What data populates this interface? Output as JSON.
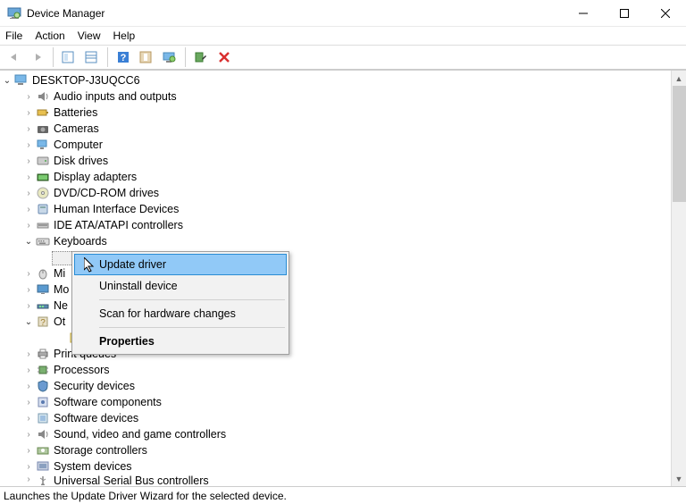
{
  "window": {
    "title": "Device Manager"
  },
  "menu": [
    "File",
    "Action",
    "View",
    "Help"
  ],
  "toolbar_icons": [
    "back",
    "forward",
    "show-hidden",
    "properties-pane",
    "help",
    "scan",
    "monitor",
    "add-legacy",
    "delete"
  ],
  "root": {
    "label": "DESKTOP-J3UQCC6"
  },
  "categories": [
    {
      "label": "Audio inputs and outputs",
      "expanded": false,
      "icon": "audio"
    },
    {
      "label": "Batteries",
      "expanded": false,
      "icon": "battery"
    },
    {
      "label": "Cameras",
      "expanded": false,
      "icon": "camera"
    },
    {
      "label": "Computer",
      "expanded": false,
      "icon": "computer"
    },
    {
      "label": "Disk drives",
      "expanded": false,
      "icon": "disk"
    },
    {
      "label": "Display adapters",
      "expanded": false,
      "icon": "display"
    },
    {
      "label": "DVD/CD-ROM drives",
      "expanded": false,
      "icon": "dvd"
    },
    {
      "label": "Human Interface Devices",
      "expanded": false,
      "icon": "hid"
    },
    {
      "label": "IDE ATA/ATAPI controllers",
      "expanded": false,
      "icon": "ide"
    },
    {
      "label": "Keyboards",
      "expanded": true,
      "icon": "keyboard"
    },
    {
      "label": "Mi",
      "expanded": false,
      "icon": "mouse",
      "truncated": true
    },
    {
      "label": "Mo",
      "expanded": false,
      "icon": "monitor",
      "truncated": true
    },
    {
      "label": "Ne",
      "expanded": false,
      "icon": "network",
      "truncated": true
    },
    {
      "label": "Ot",
      "expanded": true,
      "icon": "other",
      "truncated": true
    },
    {
      "label": "Print queues",
      "expanded": false,
      "icon": "printer"
    },
    {
      "label": "Processors",
      "expanded": false,
      "icon": "cpu"
    },
    {
      "label": "Security devices",
      "expanded": false,
      "icon": "security"
    },
    {
      "label": "Software components",
      "expanded": false,
      "icon": "swcomp"
    },
    {
      "label": "Software devices",
      "expanded": false,
      "icon": "swdev"
    },
    {
      "label": "Sound, video and game controllers",
      "expanded": false,
      "icon": "audio"
    },
    {
      "label": "Storage controllers",
      "expanded": false,
      "icon": "storage"
    },
    {
      "label": "System devices",
      "expanded": false,
      "icon": "system"
    },
    {
      "label": "Universal Serial Bus controllers",
      "expanded": false,
      "icon": "usb",
      "clipped": true
    }
  ],
  "context_menu": {
    "items": [
      {
        "label": "Update driver",
        "highlight": true
      },
      {
        "label": "Uninstall device"
      },
      {
        "sep": true
      },
      {
        "label": "Scan for hardware changes"
      },
      {
        "sep": true
      },
      {
        "label": "Properties",
        "bold": true
      }
    ]
  },
  "status": "Launches the Update Driver Wizard for the selected device."
}
